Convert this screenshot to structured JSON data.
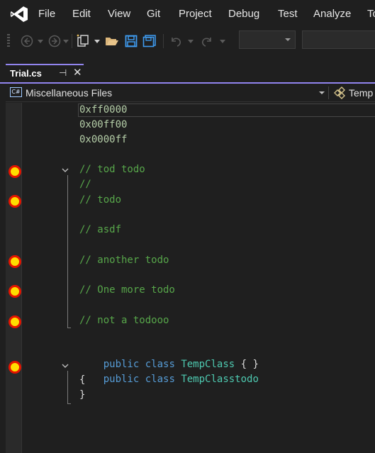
{
  "menu": {
    "items": [
      "File",
      "Edit",
      "View",
      "Git",
      "Project",
      "Debug",
      "Test",
      "Analyze",
      "To"
    ]
  },
  "tab": {
    "title": "Trial.cs",
    "pin_glyph": "⊣",
    "close_glyph": "✕"
  },
  "navbar": {
    "project_icon_text": "C#",
    "project_label": "Miscellaneous Files",
    "member_label": "Temp"
  },
  "code": {
    "lines": [
      "0xff0000",
      "0x00ff00",
      "0x0000ff",
      "// tod todo",
      "//",
      "// todo",
      "// asdf",
      "// another todo",
      "// One more todo",
      "// not a todooo",
      [
        "public",
        "class",
        "TempClass",
        "{ }"
      ],
      [
        "public",
        "class",
        "TempClasstodo"
      ],
      "{",
      "}"
    ]
  },
  "colors": {
    "keyword": "#569cd6",
    "type": "#4ec9b0",
    "comment": "#57a64a",
    "number": "#b5cea8",
    "text": "#dcdcdc",
    "breakpoint_fill": "#ffdd00",
    "breakpoint_ring": "#e51400",
    "tab_accent": "#9184ee"
  },
  "breakpoints_on_lines": [
    4,
    6,
    8,
    9,
    10,
    12
  ]
}
